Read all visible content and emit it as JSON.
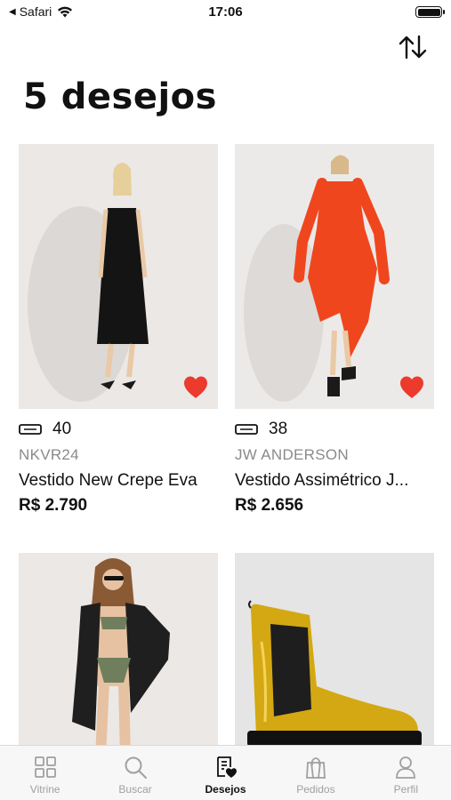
{
  "status_bar": {
    "back_app": "Safari",
    "time": "17:06"
  },
  "page": {
    "title": "5 desejos"
  },
  "colors": {
    "heart": "#ec3a2d",
    "tab_active": "#111111",
    "tab_inactive": "#a0a0a0"
  },
  "products": [
    {
      "size": "40",
      "brand": "NKVR24",
      "name": "Vestido New Crepe Eva",
      "price": "R$ 2.790",
      "favorited": true
    },
    {
      "size": "38",
      "brand": "JW ANDERSON",
      "name": "Vestido Assimétrico J...",
      "price": "R$ 2.656",
      "favorited": true
    },
    {
      "size": "",
      "brand": "",
      "name": "",
      "price": "",
      "favorited": false
    },
    {
      "size": "",
      "brand": "",
      "name": "",
      "price": "",
      "favorited": false
    }
  ],
  "tabs": [
    {
      "label": "Vitrine",
      "icon": "grid-icon",
      "active": false
    },
    {
      "label": "Buscar",
      "icon": "search-icon",
      "active": false
    },
    {
      "label": "Desejos",
      "icon": "wishlist-icon",
      "active": true
    },
    {
      "label": "Pedidos",
      "icon": "shopping-bag-icon",
      "active": false
    },
    {
      "label": "Perfil",
      "icon": "user-icon",
      "active": false
    }
  ]
}
